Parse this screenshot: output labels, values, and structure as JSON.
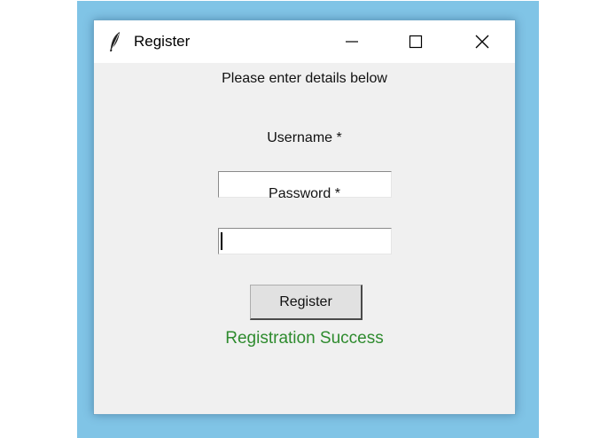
{
  "window": {
    "title": "Register",
    "icon": "feather-icon"
  },
  "titlebar_buttons": {
    "minimize": "minimize-icon",
    "maximize": "maximize-icon",
    "close": "close-icon"
  },
  "form": {
    "instructions": "Please enter details below",
    "username_label": "Username *",
    "username_value": "",
    "password_label": "Password *",
    "password_value": "",
    "register_label": "Register",
    "status_message": "Registration Success"
  },
  "colors": {
    "desktop": "#80c4e6",
    "window_bg": "#f0f0f0",
    "success": "#2e8b2e"
  }
}
